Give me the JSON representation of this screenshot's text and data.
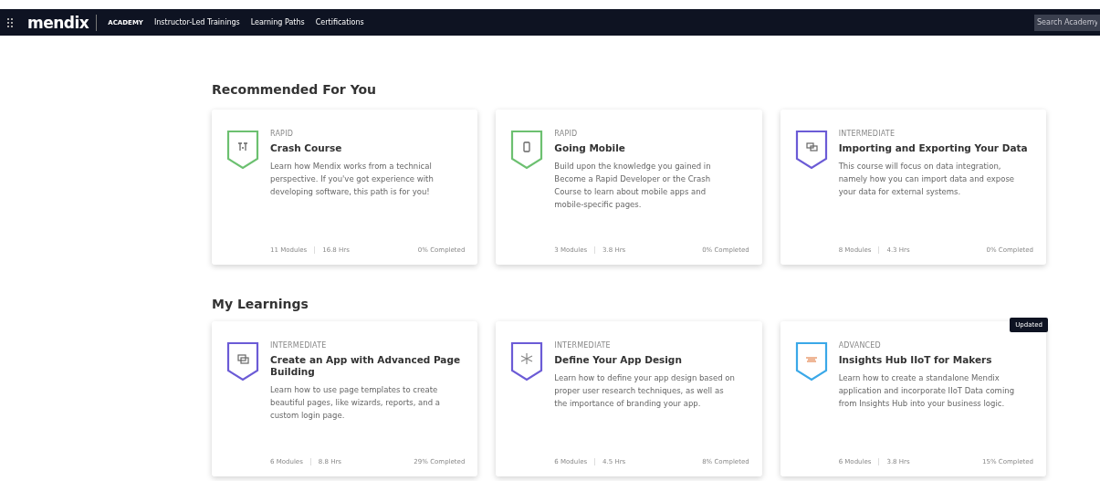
{
  "nav": {
    "brand": "mendix",
    "product": "ACADEMY",
    "links": [
      "Instructor-Led Trainings",
      "Learning Paths",
      "Certifications"
    ],
    "search": {
      "placeholder": "Search Academy"
    }
  },
  "sections": [
    {
      "title": "Recommended For You",
      "cards": [
        {
          "level": "RAPID",
          "color": "#6cc070",
          "title": "Crash Course",
          "description": "Learn how Mendix works from a technical perspective. If you've got experience with developing software, this path is for you!",
          "modules": "11 Modules",
          "hours": "16.8 Hrs",
          "progress": "0% Completed"
        },
        {
          "level": "RAPID",
          "color": "#6cc070",
          "title": "Going Mobile",
          "description": "Build upon the knowledge you gained in Become a Rapid Developer or the Crash Course to learn about mobile apps and mobile-specific pages.",
          "modules": "3 Modules",
          "hours": "3.8 Hrs",
          "progress": "0% Completed"
        },
        {
          "level": "INTERMEDIATE",
          "color": "#6b5bd6",
          "title": "Importing and Exporting Your Data",
          "description": "This course will focus on data integration, namely how you can import data and expose your data for external systems.",
          "modules": "8 Modules",
          "hours": "4.3 Hrs",
          "progress": "0% Completed"
        }
      ]
    },
    {
      "title": "My Learnings",
      "cards": [
        {
          "level": "INTERMEDIATE",
          "color": "#6b5bd6",
          "title": "Create an App with Advanced Page Building",
          "description": "Learn how to use page templates to create beautiful pages, like wizards, reports, and a custom login page.",
          "modules": "6 Modules",
          "hours": "8.8 Hrs",
          "progress": "29% Completed"
        },
        {
          "level": "INTERMEDIATE",
          "color": "#6b5bd6",
          "title": "Define Your App Design",
          "description": "Learn how to define your app design based on proper user research techniques, as well as the importance of branding your app.",
          "modules": "6 Modules",
          "hours": "4.5 Hrs",
          "progress": "8% Completed"
        },
        {
          "level": "ADVANCED",
          "color": "#3aa8e8",
          "title": "Insights Hub IIoT for Makers",
          "description": "Learn how to create a standalone Mendix application and incorporate IIoT Data coming from Insights Hub into your business logic.",
          "modules": "6 Modules",
          "hours": "3.8 Hrs",
          "progress": "15% Completed",
          "tag": "Updated"
        }
      ]
    }
  ]
}
